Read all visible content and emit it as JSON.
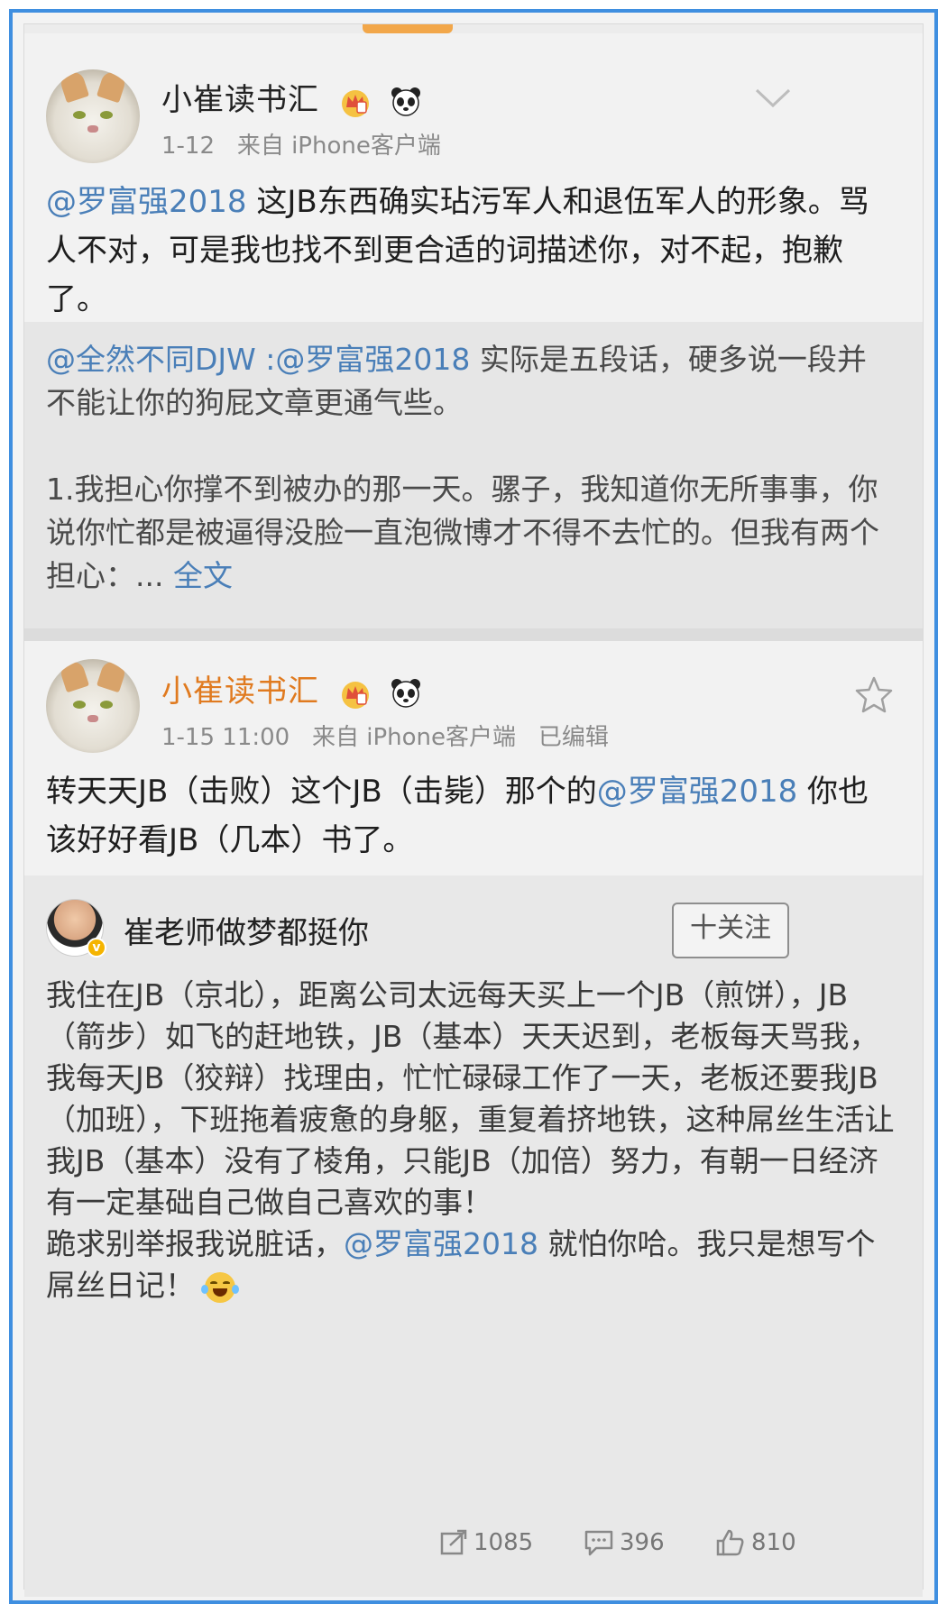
{
  "post1": {
    "author": "小崔读书汇",
    "time": "1-12",
    "source": "来自 iPhone客户端",
    "mention": "@罗富强2018",
    "text": " 这JB东西确实玷污军人和退伍军人的形象。骂人不对，可是我也找不到更合适的词描述你，对不起，抱歉了。",
    "repost": {
      "author_mention": "@全然不同DJW",
      "separator": " :",
      "mention": "@罗富强2018",
      "text1": " 实际是五段话，硬多说一段并不能让你的狗屁文章更通气些。",
      "text2": "1.我担心你撑不到被办的那一天。骡子，我知道你无所事事，你说你忙都是被逼得没脸一直泡微博才不得不去忙的。但我有两个担心：... ",
      "full_text_link": "全文"
    }
  },
  "post2": {
    "author": "小崔读书汇",
    "time": "1-15 11:00",
    "source": "来自 iPhone客户端",
    "edited": "已编辑",
    "text_a": "转天天JB（击败）这个JB（击毙）那个的",
    "mention": "@罗富强2018",
    "text_b": " 你也该好好看JB（几本）书了。",
    "comment": {
      "author": "崔老师做梦都挺你",
      "follow_label": "十关注",
      "text1": "我住在JB（京北），距离公司太远每天买上一个JB（煎饼），JB（箭步）如飞的赶地铁，JB（基本）天天迟到，老板每天骂我，我每天JB（狡辩）找理由，忙忙碌碌工作了一天，老板还要我JB（加班），下班拖着疲惫的身躯，重复着挤地铁，这种屌丝生活让我JB（基本）没有了棱角，只能JB（加倍）努力，有朝一日经济有一定基础自己做自己喜欢的事！",
      "text2a": "跪求别举报我说脏话，",
      "mention": "@罗富强2018",
      "text2b": " 就怕你哈。我只是想写个屌丝日记！"
    },
    "actions": {
      "repost_count": "1085",
      "comment_count": "396",
      "like_count": "810"
    }
  },
  "colors": {
    "link": "#4a7fb8",
    "orange_name": "#e07a1f",
    "frame": "#3f8fe0"
  }
}
